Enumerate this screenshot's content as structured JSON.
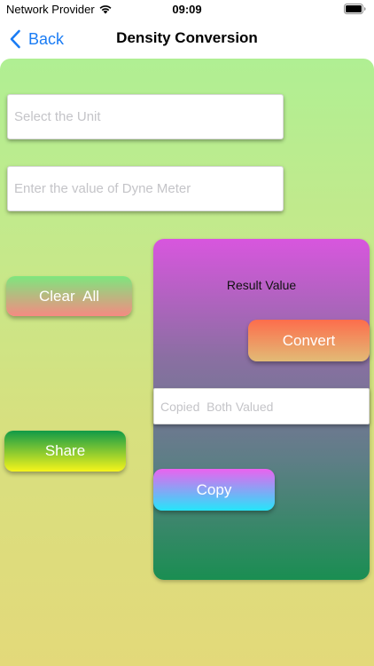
{
  "status_bar": {
    "carrier": "Network Provider",
    "time": "09:09"
  },
  "nav": {
    "back_label": "Back",
    "title": "Density Conversion"
  },
  "form": {
    "unit_placeholder": "Select the Unit",
    "value_placeholder": "Enter the value of Dyne Meter",
    "clear_label": "Clear  All",
    "share_label": "Share"
  },
  "result": {
    "label": "Result Value",
    "convert_label": "Convert",
    "copied_placeholder": "Copied  Both Valued",
    "copy_label": "Copy"
  },
  "colors": {
    "accent": "#1a7cf4",
    "background_top": "#b0ef93",
    "background_bottom": "#e3d97a"
  },
  "icons": {
    "wifi": "wifi-icon",
    "battery": "battery-icon",
    "back": "chevron-left-icon"
  }
}
